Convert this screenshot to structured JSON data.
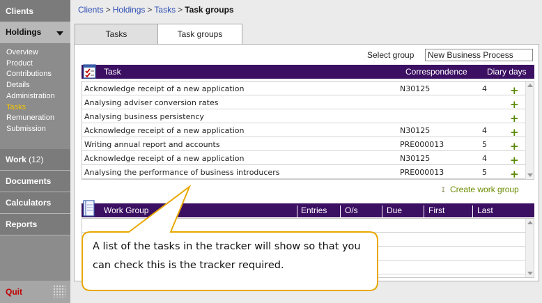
{
  "sidebar": {
    "clients": "Clients",
    "holdings": "Holdings",
    "subnav": [
      "Overview",
      "Product",
      "Contributions",
      "Details",
      "Administration",
      "Tasks",
      "Remuneration",
      "Submission"
    ],
    "current_item": "Tasks",
    "work": "Work",
    "work_count": "(12)",
    "documents": "Documents",
    "calculators": "Calculators",
    "reports": "Reports",
    "quit": "Quit"
  },
  "breadcrumb": {
    "clients": "Clients",
    "holdings": "Holdings",
    "tasks": "Tasks",
    "current": "Task groups",
    "separator": ">"
  },
  "tabs": [
    "Tasks",
    "Task groups"
  ],
  "active_tab": "Task groups",
  "select_group": {
    "label": "Select group",
    "value": "New Business Process"
  },
  "task_table": {
    "headers": {
      "task": "Task",
      "correspondence": "Correspondence",
      "diary_days": "Diary days"
    },
    "rows": [
      {
        "task": "Acknowledge receipt of a new application",
        "correspondence": "N30125",
        "diary_days": "4"
      },
      {
        "task": "Analysing adviser conversion rates",
        "correspondence": "",
        "diary_days": ""
      },
      {
        "task": "Analysing business persistency",
        "correspondence": "",
        "diary_days": ""
      },
      {
        "task": "Acknowledge receipt of a new application",
        "correspondence": "N30125",
        "diary_days": "4"
      },
      {
        "task": "Writing annual report and accounts",
        "correspondence": "PRE000013",
        "diary_days": "5"
      },
      {
        "task": "Acknowledge receipt of a new application",
        "correspondence": "N30125",
        "diary_days": "4"
      },
      {
        "task": "Analysing the performance of business introducers",
        "correspondence": "PRE000013",
        "diary_days": "5"
      }
    ],
    "add_symbol": "+"
  },
  "create_work_group": "Create work group",
  "work_group_table": {
    "headers": [
      "Work Group",
      "Entries",
      "O/s",
      "Due",
      "First",
      "Last"
    ]
  },
  "callout_text": "A list of the tasks in the tracker will show so that you can check this is the tracker required.",
  "colors": {
    "header_bar": "#3b0f62",
    "sidebar": "#8c8c8c",
    "current_nav": "#f2c400",
    "quit": "#c00000",
    "add_icon": "#5a8a00",
    "link": "#2f4fb5",
    "callout_border": "#e8a800"
  },
  "icons": [
    "task-checklist-icon",
    "work-group-book-icon",
    "create-work-group-icon",
    "grip-icon",
    "chevron-down-icon",
    "add-icon"
  ]
}
